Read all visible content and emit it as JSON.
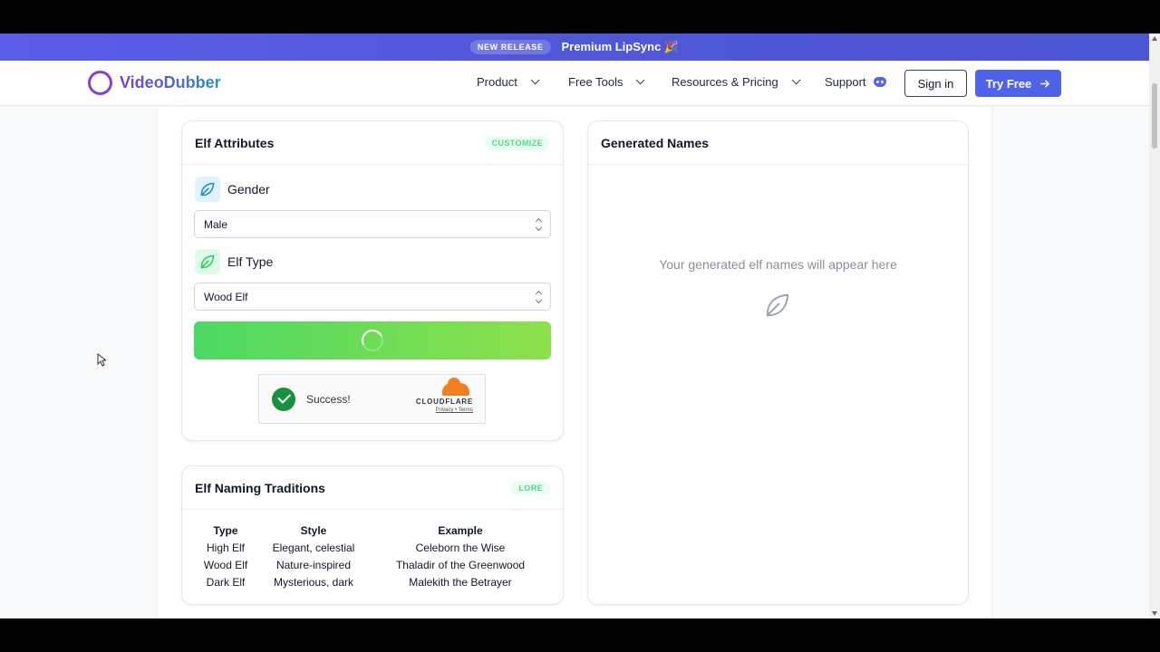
{
  "banner": {
    "badge": "NEW RELEASE",
    "text": "Premium LipSync 🎉"
  },
  "nav": {
    "logo": "VideoDubber",
    "items": [
      {
        "label": "Product"
      },
      {
        "label": "Free Tools"
      },
      {
        "label": "Resources & Pricing"
      },
      {
        "label": "Support"
      }
    ],
    "signin": "Sign in",
    "try_free": "Try Free"
  },
  "attributes_card": {
    "title": "Elf Attributes",
    "pill": "CUSTOMIZE",
    "gender_label": "Gender",
    "gender_value": "Male",
    "type_label": "Elf Type",
    "type_value": "Wood Elf"
  },
  "turnstile": {
    "status": "Success!",
    "brand": "CLOUDFLARE",
    "links": "Privacy • Terms"
  },
  "lore_card": {
    "title": "Elf Naming Traditions",
    "pill": "LORE",
    "headers": [
      "Type",
      "Style",
      "Example"
    ],
    "rows": [
      [
        "High Elf",
        "Elegant, celestial",
        "Celeborn the Wise"
      ],
      [
        "Wood Elf",
        "Nature-inspired",
        "Thaladir of the Greenwood"
      ],
      [
        "Dark Elf",
        "Mysterious, dark",
        "Malekith the Betrayer"
      ]
    ]
  },
  "names_card": {
    "title": "Generated Names",
    "placeholder": "Your generated elf names will appear here"
  },
  "colors": {
    "accent": "#4e63e8",
    "green": "#4cd964",
    "banner": "#5b5ee8"
  }
}
